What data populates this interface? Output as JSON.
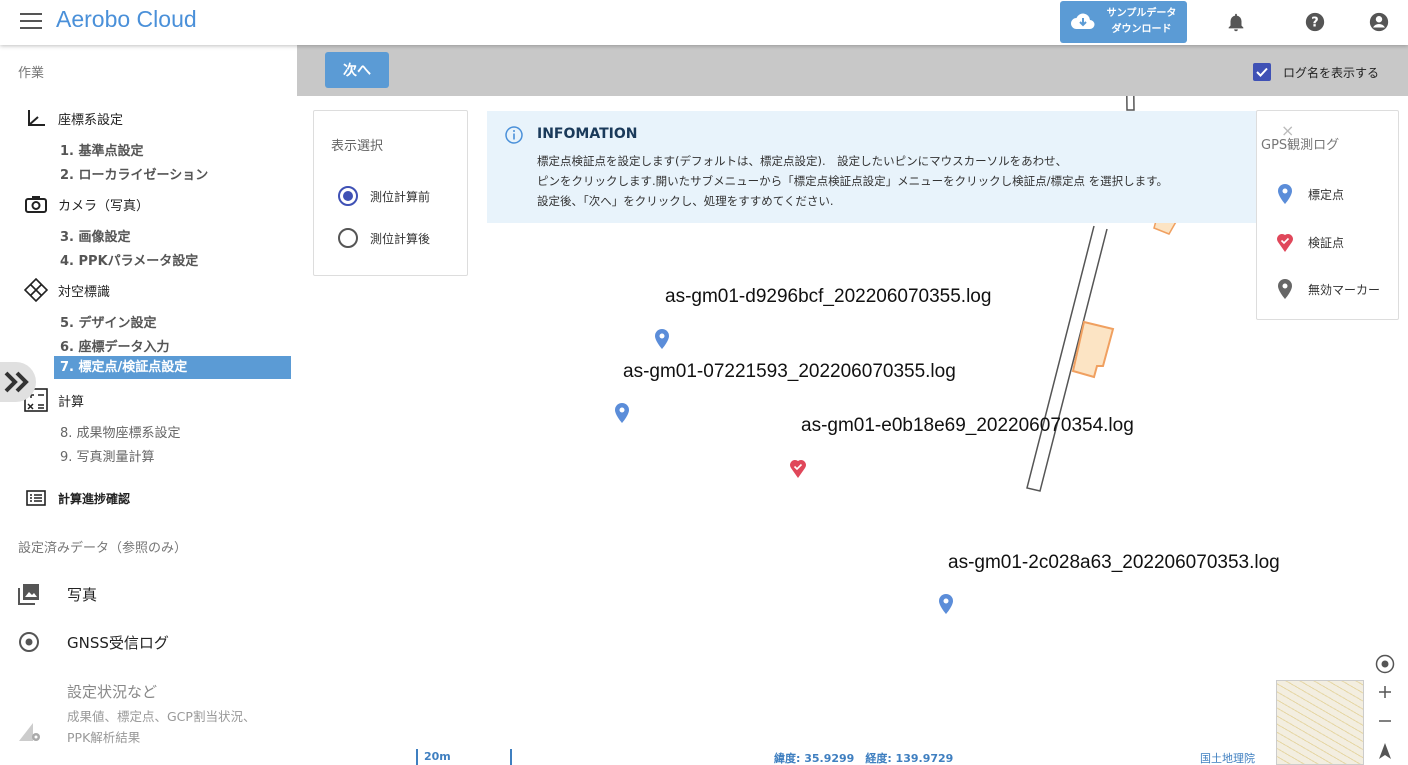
{
  "header": {
    "title": "Aerobo Cloud",
    "sample_line1": "サンプルデータ",
    "sample_line2": "ダウンロード"
  },
  "sidebar": {
    "work_title": "作業",
    "groups": [
      {
        "label": "座標系設定",
        "icon": "axis-icon"
      },
      {
        "label": "カメラ（写真）",
        "icon": "camera-icon"
      },
      {
        "label": "対空標識",
        "icon": "target-icon"
      },
      {
        "label": "計算",
        "icon": "calculator-icon"
      },
      {
        "label": "計算進捗確認",
        "icon": "list-icon"
      }
    ],
    "steps": [
      "1. 基準点設定",
      "2. ローカライゼーション",
      "3. 画像設定",
      "4. PPKパラメータ設定",
      "5. デザイン設定",
      "6. 座標データ入力",
      "7. 標定点/検証点設定",
      "8. 成果物座標系設定",
      "9. 写真測量計算"
    ],
    "ref_title": "設定済みデータ（参照のみ）",
    "ref_items": [
      "写真",
      "GNSS受信ログ",
      "設定状況など"
    ],
    "ref_sub1": "成果値、標定点、GCP割当状況、",
    "ref_sub2": "PPK解析結果"
  },
  "toolbar": {
    "next_label": "次へ",
    "show_log_label": "ログ名を表示する",
    "show_log_checked": true
  },
  "display_panel": {
    "title": "表示選択",
    "options": [
      "測位計算前",
      "測位計算後"
    ],
    "selected": "測位計算前"
  },
  "info": {
    "title": "INFOMATION",
    "line1": "標定点検証点を設定します(デフォルトは、標定点設定).　設定したいピンにマウスカーソルをあわせ、",
    "line2": "ピンをクリックします.開いたサブメニューから「標定点検証点設定」メニューをクリックし検証点/標定点 を選択します。",
    "line3": "設定後、「次へ」をクリックし、処理をすすめてください."
  },
  "legend": {
    "close": "×",
    "title": "GPS観測ログ",
    "items": [
      {
        "label": "標定点",
        "color": "#5b8dd9"
      },
      {
        "label": "検証点",
        "color": "#e0475a"
      },
      {
        "label": "無効マーカー",
        "color": "#666666"
      }
    ]
  },
  "map": {
    "logs": [
      {
        "name": "as-gm01-d9296bcf_202206070355.log",
        "type": "標定点"
      },
      {
        "name": "as-gm01-07221593_202206070355.log",
        "type": "標定点"
      },
      {
        "name": "as-gm01-e0b18e69_202206070354.log",
        "type": "検証点"
      },
      {
        "name": "as-gm01-2c028a63_202206070353.log",
        "type": "標定点"
      }
    ],
    "scale": "20m",
    "coords": "緯度: 35.9299　経度: 139.9729",
    "attribution": "国土地理院"
  },
  "colors": {
    "accent": "#5b9bd5",
    "brand": "#4a90d9",
    "control_point": "#5b8dd9",
    "check_point": "#e0475a"
  }
}
